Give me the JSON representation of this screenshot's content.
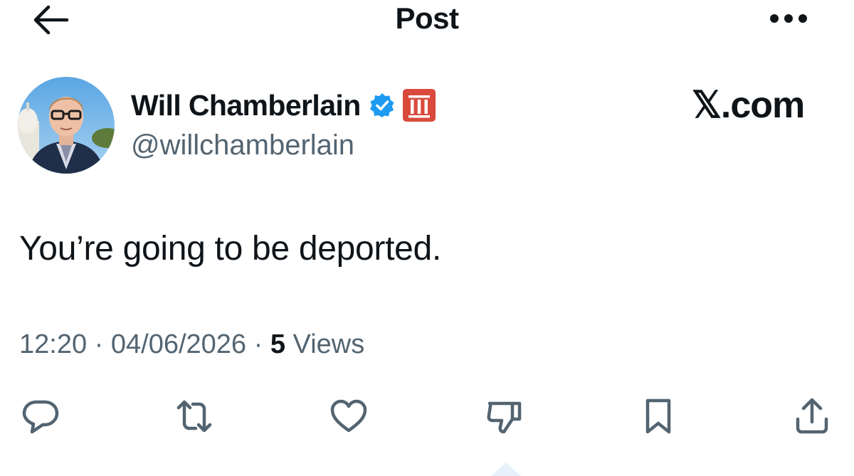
{
  "header": {
    "title": "Post",
    "back_icon": "arrow-left-icon",
    "more_icon": "more-horizontal-icon"
  },
  "author": {
    "display_name": "Will Chamberlain",
    "handle": "@willchamberlain",
    "verified_icon": "verified-badge-icon",
    "affiliate_icon": "affiliate-badge-icon",
    "verified_color": "#1d9bf0",
    "affiliate_color": "#d94a3d"
  },
  "source": {
    "logo_text": "𝕏.com"
  },
  "post": {
    "text": "You’re going to be deported."
  },
  "meta": {
    "time": "12:20",
    "separator": "·",
    "date": "04/06/2026",
    "views_count": "5",
    "views_label": "Views"
  },
  "actions": [
    {
      "name": "reply",
      "icon": "reply-icon"
    },
    {
      "name": "repost",
      "icon": "repost-icon"
    },
    {
      "name": "like",
      "icon": "heart-icon"
    },
    {
      "name": "dislike",
      "icon": "thumbs-down-icon"
    },
    {
      "name": "bookmark",
      "icon": "bookmark-icon"
    },
    {
      "name": "share",
      "icon": "share-icon"
    }
  ],
  "colors": {
    "text_primary": "#0f1419",
    "text_secondary": "#536471",
    "background": "#ffffff"
  }
}
